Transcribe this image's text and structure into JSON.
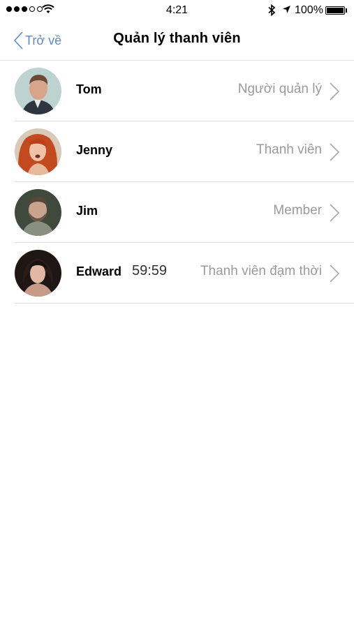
{
  "status_bar": {
    "time": "4:21",
    "battery": "100%"
  },
  "nav": {
    "back_label": "Trở về",
    "title": "Quản lý thanh viên"
  },
  "members": [
    {
      "name": "Tom",
      "role": "Người quản lý",
      "timer": ""
    },
    {
      "name": "Jenny",
      "role": "Thanh viên",
      "timer": ""
    },
    {
      "name": "Jim",
      "role": "Member",
      "timer": ""
    },
    {
      "name": "Edward",
      "role": "Thanh viên đạm thời",
      "timer": "59:59"
    }
  ],
  "colors": {
    "accent": "#5b8ac6",
    "secondary_text": "#9a9a9a",
    "divider": "#dcdcdc"
  }
}
